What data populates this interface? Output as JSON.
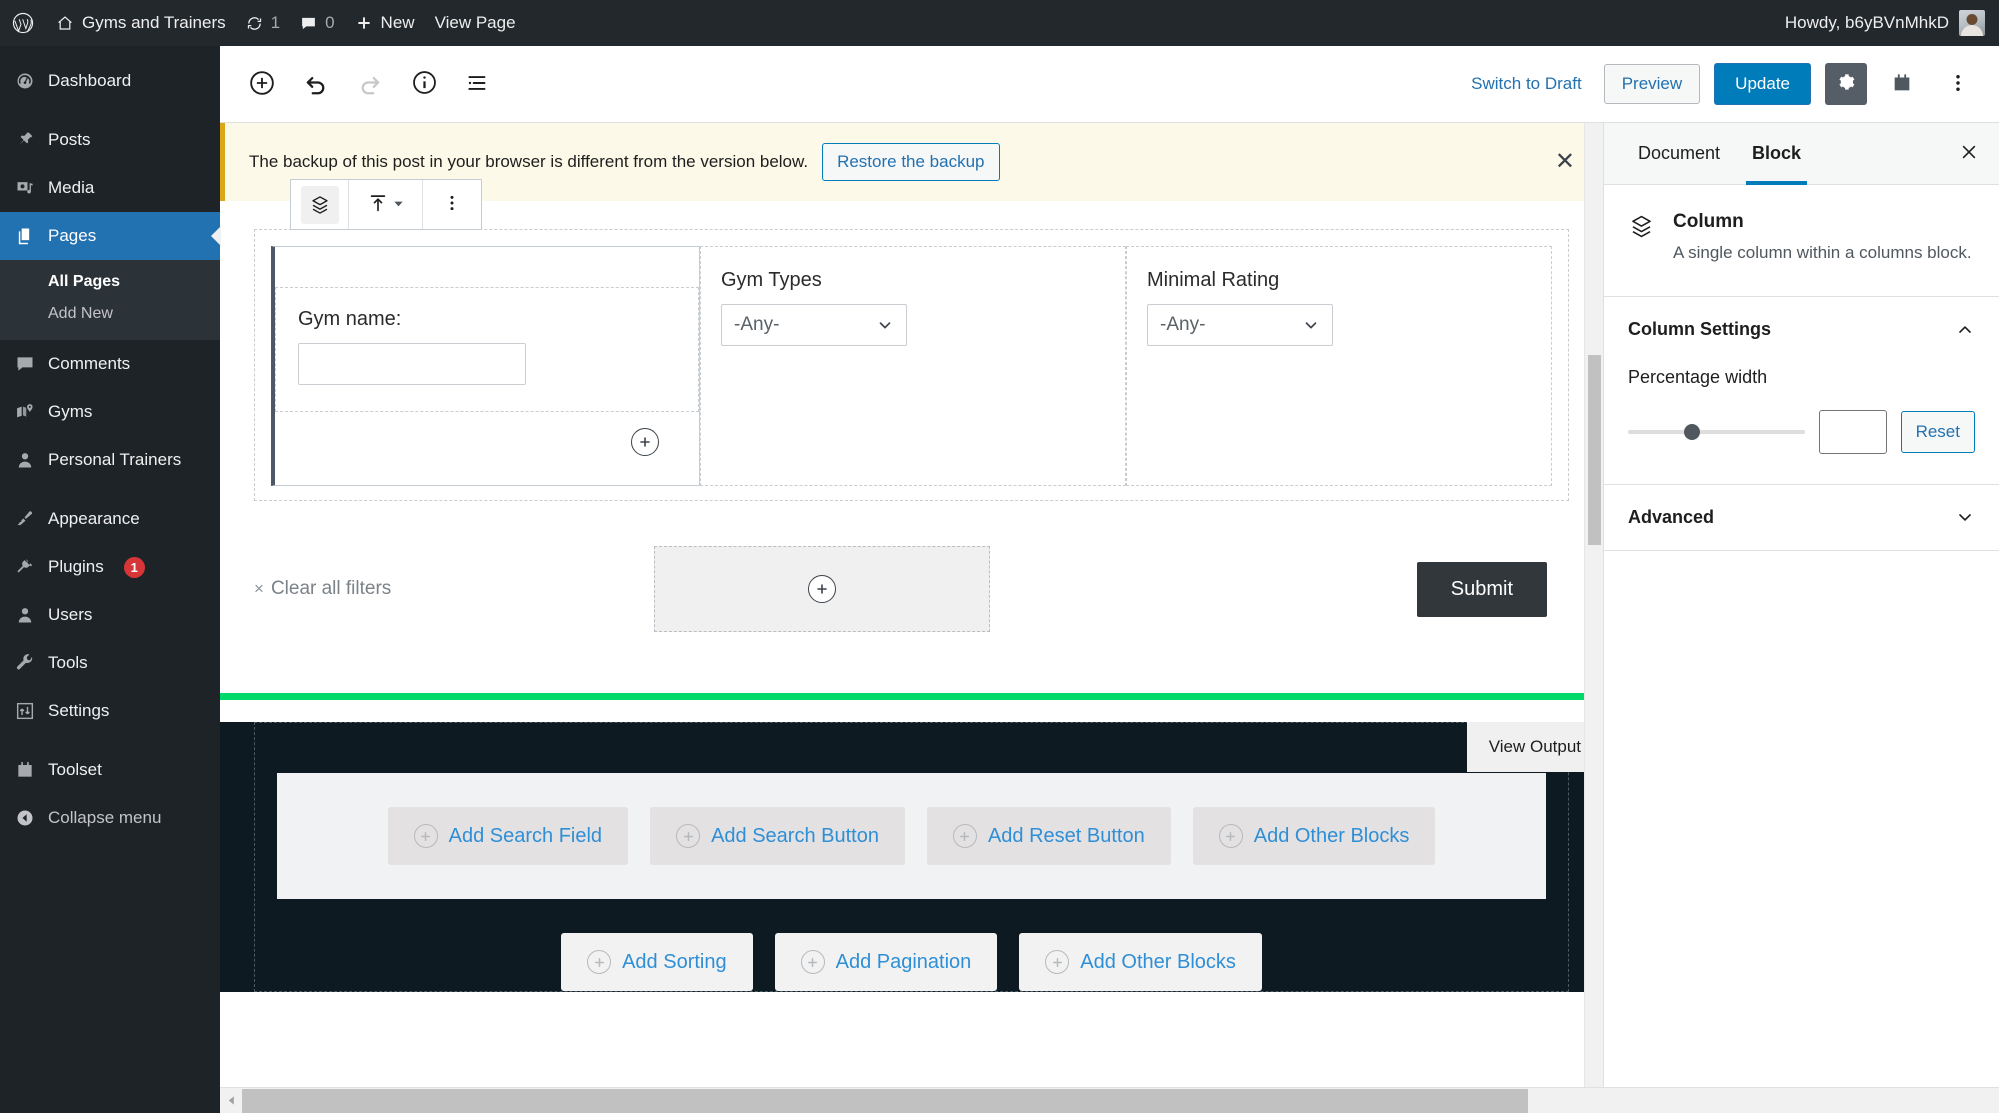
{
  "adminbar": {
    "logo_icon": "wordpress-logo-icon",
    "site_icon": "home-icon",
    "site_name": "Gyms and Trainers",
    "updates_icon": "updates-icon",
    "updates_count": "1",
    "comments_icon": "comment-bubble-icon",
    "comments_count": "0",
    "new_icon": "plus-icon",
    "new_label": "New",
    "view_page_label": "View Page",
    "howdy": "Howdy, b6yBVnMhkD",
    "avatar_icon": "avatar"
  },
  "sidebar": {
    "items": [
      {
        "label": "Dashboard",
        "icon": "dashboard-icon"
      },
      {
        "label": "Posts",
        "icon": "pin-icon"
      },
      {
        "label": "Media",
        "icon": "media-icon"
      },
      {
        "label": "Pages",
        "icon": "pages-icon",
        "active": true
      },
      {
        "label": "Comments",
        "icon": "comment-bubble-icon"
      },
      {
        "label": "Gyms",
        "icon": "map-marker-icon"
      },
      {
        "label": "Personal Trainers",
        "icon": "user-icon"
      },
      {
        "label": "Appearance",
        "icon": "paintbrush-icon"
      },
      {
        "label": "Plugins",
        "icon": "plug-icon",
        "badge": "1"
      },
      {
        "label": "Users",
        "icon": "user-icon"
      },
      {
        "label": "Tools",
        "icon": "wrench-icon"
      },
      {
        "label": "Settings",
        "icon": "sliders-icon"
      },
      {
        "label": "Toolset",
        "icon": "toolset-icon"
      },
      {
        "label": "Collapse menu",
        "icon": "collapse-arrow-icon"
      }
    ],
    "submenu": [
      {
        "label": "All Pages",
        "current": true
      },
      {
        "label": "Add New",
        "current": false
      }
    ]
  },
  "editor_header": {
    "add_block_icon": "circle-plus-icon",
    "undo_icon": "undo-icon",
    "redo_icon": "redo-icon",
    "info_icon": "info-icon",
    "list_view_icon": "list-view-icon",
    "switch_to_draft": "Switch to Draft",
    "preview": "Preview",
    "update": "Update",
    "settings_icon": "gear-icon",
    "toolset_icon": "toolset-icon",
    "more_icon": "kebab-menu-icon"
  },
  "notice": {
    "text": "The backup of this post in your browser is different from the version below.",
    "button": "Restore the backup",
    "close_icon": "close-icon"
  },
  "block_toolbar": {
    "block_type_icon": "column-layers-icon",
    "vertical_align_icon": "align-top-icon",
    "dropdown_icon": "chevron-down-icon",
    "more_icon": "kebab-menu-icon"
  },
  "form": {
    "fields": [
      {
        "label": "Gym name:",
        "type": "text",
        "value": ""
      },
      {
        "label": "Gym Types",
        "type": "select",
        "value": "-Any-"
      },
      {
        "label": "Minimal Rating",
        "type": "select",
        "value": "-Any-"
      }
    ],
    "appender_icon": "circle-plus-icon",
    "clear_filters_x": "×",
    "clear_filters": "Clear all filters",
    "submit": "Submit"
  },
  "results_section": {
    "search_chips": [
      {
        "label": "Add Search Field",
        "icon": "circle-plus-icon"
      },
      {
        "label": "Add Search Button",
        "icon": "circle-plus-icon"
      },
      {
        "label": "Add Reset Button",
        "icon": "circle-plus-icon"
      },
      {
        "label": "Add Other Blocks",
        "icon": "circle-plus-icon"
      }
    ],
    "bottom_chips": [
      {
        "label": "Add Sorting",
        "icon": "circle-plus-icon"
      },
      {
        "label": "Add Pagination",
        "icon": "circle-plus-icon"
      },
      {
        "label": "Add Other Blocks",
        "icon": "circle-plus-icon"
      }
    ],
    "view_output": "View Output"
  },
  "right_panel": {
    "tabs": [
      {
        "label": "Document",
        "active": false
      },
      {
        "label": "Block",
        "active": true
      }
    ],
    "close_icon": "close-icon",
    "block_icon": "column-layers-icon",
    "block_title": "Column",
    "block_desc": "A single column within a columns block.",
    "column_settings": {
      "title": "Column Settings",
      "chevron": "chevron-up-icon",
      "field_label": "Percentage width",
      "slider_value": "",
      "input_value": "",
      "reset": "Reset"
    },
    "advanced": {
      "title": "Advanced",
      "chevron": "chevron-down-icon"
    }
  },
  "overlays": {
    "grammarly_icon": "grammarly-icon"
  },
  "colors": {
    "wp_blue": "#007cba",
    "sidebar_dark": "#1d2327",
    "admin_bar": "#23282d",
    "active_blue": "#2271b1",
    "notice_bg": "#fcf9e8",
    "notice_border": "#dba617",
    "badge_red": "#d63638",
    "green_divider": "#00d96a",
    "dark_section": "#0d1a22",
    "submit_dark": "#32373c",
    "grammarly_green": "#15c39a"
  }
}
